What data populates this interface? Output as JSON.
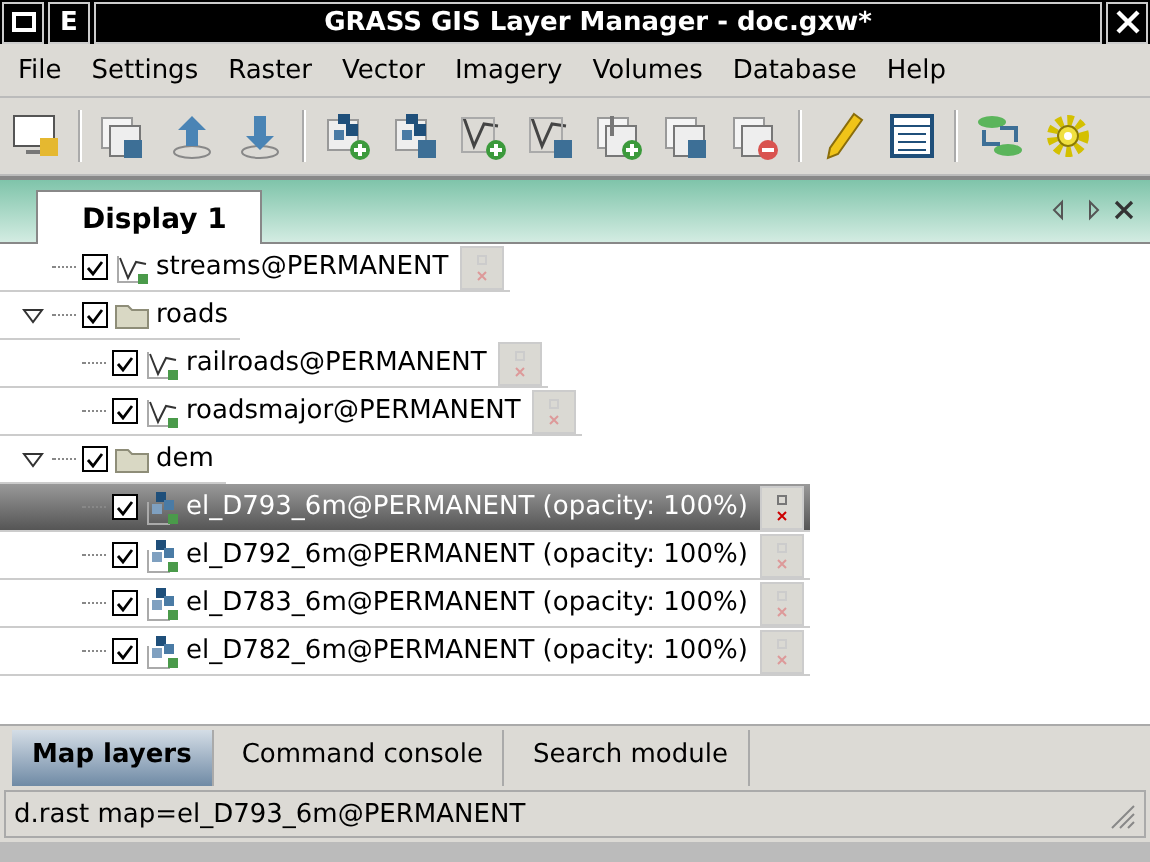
{
  "window": {
    "title": "GRASS GIS Layer Manager - doc.gxw*",
    "left_button": "E"
  },
  "menu": [
    "File",
    "Settings",
    "Raster",
    "Vector",
    "Imagery",
    "Volumes",
    "Database",
    "Help"
  ],
  "display_tabs": [
    {
      "label": "Display 1",
      "selected": true
    }
  ],
  "layers": [
    {
      "kind": "vector",
      "label": "streams@PERMANENT",
      "checked": true,
      "selected": false
    },
    {
      "kind": "group",
      "label": "roads",
      "checked": true,
      "selected": false,
      "expanded": true,
      "children": [
        {
          "kind": "vector",
          "label": "railroads@PERMANENT",
          "checked": true,
          "selected": false
        },
        {
          "kind": "vector",
          "label": "roadsmajor@PERMANENT",
          "checked": true,
          "selected": false
        }
      ]
    },
    {
      "kind": "group",
      "label": "dem",
      "checked": true,
      "selected": false,
      "expanded": true,
      "children": [
        {
          "kind": "raster",
          "label": "el_D793_6m@PERMANENT (opacity: 100%)",
          "checked": true,
          "selected": true
        },
        {
          "kind": "raster",
          "label": "el_D792_6m@PERMANENT (opacity: 100%)",
          "checked": true,
          "selected": false
        },
        {
          "kind": "raster",
          "label": "el_D783_6m@PERMANENT (opacity: 100%)",
          "checked": true,
          "selected": false
        },
        {
          "kind": "raster",
          "label": "el_D782_6m@PERMANENT (opacity: 100%)",
          "checked": true,
          "selected": false
        }
      ]
    }
  ],
  "bottom_tabs": [
    {
      "label": "Map layers",
      "selected": true
    },
    {
      "label": "Command console",
      "selected": false
    },
    {
      "label": "Search module",
      "selected": false
    }
  ],
  "status_bar": "d.rast map=el_D793_6m@PERMANENT"
}
